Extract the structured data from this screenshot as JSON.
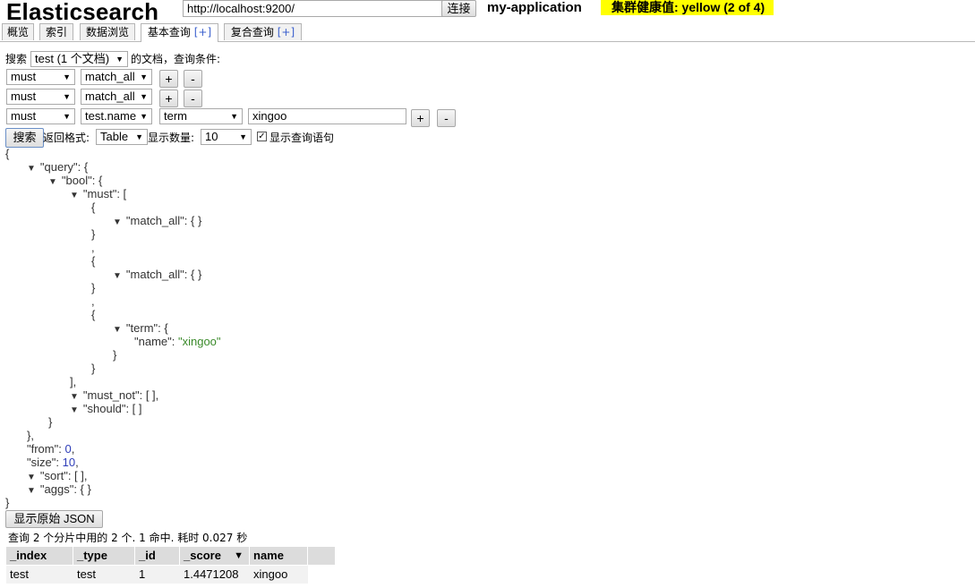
{
  "header": {
    "app_title": "Elasticsearch",
    "url": "http://localhost:9200/",
    "connect_label": "连接",
    "cluster_name": "my-application",
    "health_text": "集群健康值: yellow (2 of 4)",
    "health_color": "#ffff00"
  },
  "tabs": [
    {
      "label": "概览"
    },
    {
      "label": "索引"
    },
    {
      "label": "数据浏览"
    },
    {
      "label": "基本查询",
      "plus": "[+]"
    },
    {
      "label": "复合查询",
      "plus": "[+]"
    }
  ],
  "search_form": {
    "prefix": "搜索",
    "index_select": "test (1 个文档)",
    "suffix": "的文档，查询条件:",
    "rows": [
      {
        "occur": "must",
        "field": "match_all"
      },
      {
        "occur": "must",
        "field": "match_all"
      },
      {
        "occur": "must",
        "field": "test.name",
        "op": "term",
        "value": "xingoo"
      }
    ],
    "plus_label": "+",
    "minus_label": "-",
    "search_label": "搜索",
    "format_label": "返回格式:",
    "format_value": "Table",
    "size_label": "显示数量:",
    "size_value": "10",
    "show_query_label": "显示查询语句",
    "show_query_checked": true
  },
  "query_json": [
    {
      "t": "{"
    },
    {
      "k": "\"query\"",
      "p": ": {",
      "tri": true
    },
    {
      "k": "\"bool\"",
      "p": ": {",
      "tri": true
    },
    {
      "k": "\"must\"",
      "p": ": [",
      "tri": true
    },
    {
      "t": "{"
    },
    {
      "k": "\"match_all\"",
      "p": ": { }",
      "tri": true
    },
    {
      "t": "}"
    },
    {
      "t": ","
    },
    {
      "t": "{"
    },
    {
      "k": "\"match_all\"",
      "p": ": { }",
      "tri": true
    },
    {
      "t": "}"
    },
    {
      "t": ","
    },
    {
      "t": "{"
    },
    {
      "k": "\"term\"",
      "p": ": {",
      "tri": true
    },
    {
      "k": "\"name\"",
      "p": ": ",
      "v": "\"xingoo\"",
      "vt": "str"
    },
    {
      "t": "}"
    },
    {
      "t": "}"
    },
    {
      "t": "],"
    },
    {
      "k": "\"must_not\"",
      "p": ": [ ],",
      "tri": true
    },
    {
      "k": "\"should\"",
      "p": ": [ ]",
      "tri": true
    },
    {
      "t": "}"
    },
    {
      "t": "},"
    },
    {
      "k": "\"from\"",
      "p": ": ",
      "v": "0",
      "vt": "num",
      "s": ","
    },
    {
      "k": "\"size\"",
      "p": ": ",
      "v": "10",
      "vt": "num",
      "s": ","
    },
    {
      "k": "\"sort\"",
      "p": ": [ ],",
      "tri": true
    },
    {
      "k": "\"aggs\"",
      "p": ": { }",
      "tri": true
    },
    {
      "t": "}"
    }
  ],
  "results": {
    "raw_json_label": "显示原始 JSON",
    "summary": "查询 2 个分片中用的 2 个. 1 命中. 耗时 0.027 秒",
    "columns": [
      "_index",
      "_type",
      "_id",
      "_score",
      "name"
    ],
    "sort_indicator": "▼",
    "rows": [
      [
        "test",
        "test",
        "1",
        "1.4471208",
        "xingoo"
      ]
    ]
  },
  "icons": {
    "dropdown": "▼",
    "tree_toggle": "▼",
    "checkmark": "✓"
  }
}
